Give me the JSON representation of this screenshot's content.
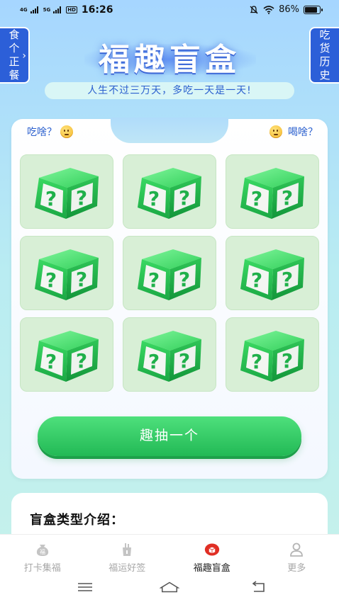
{
  "status_bar": {
    "net1": "4G",
    "net2": "5G",
    "hd": "HD",
    "time": "16:26",
    "battery_text": "86%",
    "battery_level": 0.86
  },
  "side_left": {
    "chars": [
      "食",
      "个",
      "正",
      "餐"
    ],
    "chevron": "›"
  },
  "side_right": {
    "chars": [
      "吃",
      "货",
      "历",
      "史"
    ]
  },
  "header": {
    "title": "福趣盲盒",
    "subtitle": "人生不过三万天，多吃一天是一天!"
  },
  "card": {
    "tab_eat": "吃啥？",
    "tab_drink": "喝啥？",
    "boxes": [
      "mystery-box",
      "mystery-box",
      "mystery-box",
      "mystery-box",
      "mystery-box",
      "mystery-box",
      "mystery-box",
      "mystery-box",
      "mystery-box"
    ],
    "draw_button": "趣抽一个"
  },
  "intro": {
    "title": "盲盒类型介绍："
  },
  "bottom_nav": [
    {
      "label": "打卡集福",
      "icon": "fu-bag-icon",
      "active": false
    },
    {
      "label": "福运好签",
      "icon": "fortune-stick-icon",
      "active": false
    },
    {
      "label": "福趣盲盒",
      "icon": "blind-box-icon",
      "active": true
    },
    {
      "label": "更多",
      "icon": "person-icon",
      "active": false
    }
  ],
  "colors": {
    "accent_blue": "#2c5fd8",
    "green": "#22b955",
    "active_red": "#e02e24"
  }
}
